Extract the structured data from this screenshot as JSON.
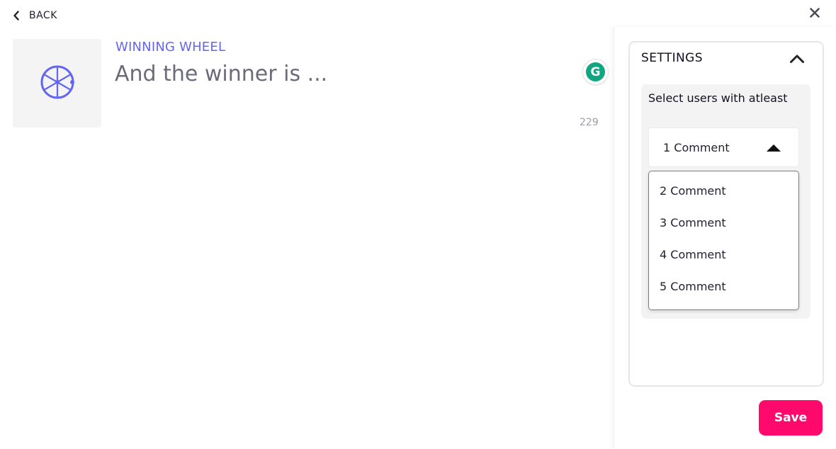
{
  "nav": {
    "back_label": "BACK",
    "back_icon": "chevron-left-icon",
    "close_icon": "close-icon"
  },
  "game": {
    "type_label": "WINNING WHEEL",
    "title_value": "And the winner is ...",
    "char_count": "229",
    "thumbnail_icon": "wheel-icon",
    "accent_color": "#6366f1"
  },
  "grammarly": {
    "letter": "G",
    "color": "#11a683"
  },
  "settings": {
    "title": "SETTINGS",
    "collapse_icon": "chevron-up-icon",
    "select_label": "Select users with atleast",
    "selected_value": "1 Comment",
    "options": [
      "2 Comment",
      "3 Comment",
      "4 Comment",
      "5 Comment"
    ]
  },
  "actions": {
    "save_label": "Save",
    "save_color": "#ff0a6c"
  }
}
